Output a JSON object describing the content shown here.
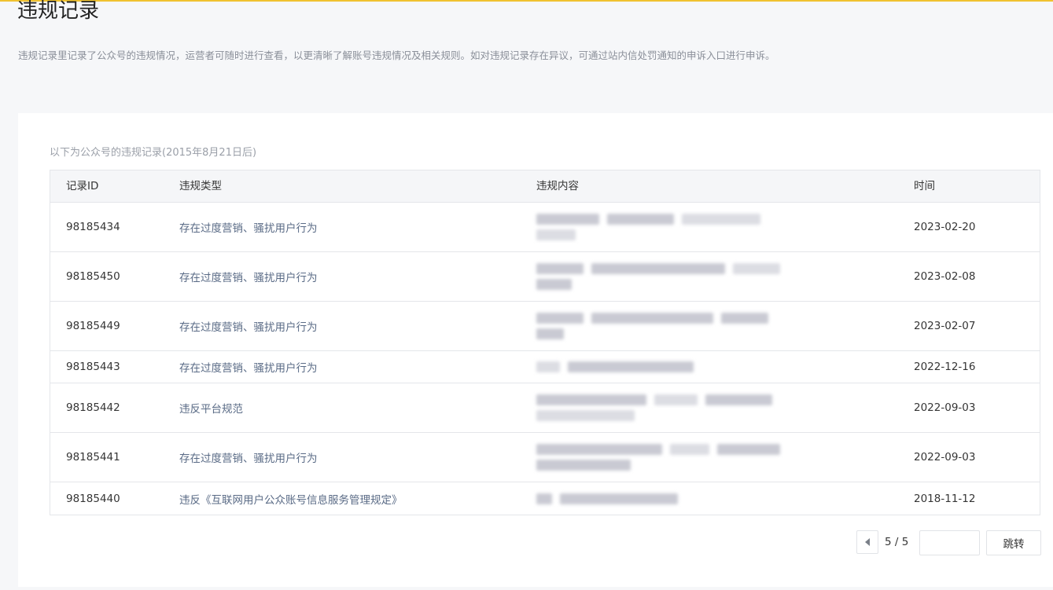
{
  "page": {
    "title": "违规记录",
    "description": "违规记录里记录了公众号的违规情况，运营者可随时进行查看，以更清晰了解账号违规情况及相关规则。如对违规记录存在异议，可通过站内信处罚通知的申诉入口进行申诉。",
    "accent_color": "#f0c230"
  },
  "table": {
    "caption": "以下为公众号的违规记录(2015年8月21日后)",
    "headers": {
      "id": "记录ID",
      "type": "违规类型",
      "content": "违规内容",
      "time": "时间"
    },
    "rows": [
      {
        "id": "98185434",
        "type": "存在过度营销、骚扰用户行为",
        "time": "2023-02-20"
      },
      {
        "id": "98185450",
        "type": "存在过度营销、骚扰用户行为",
        "time": "2023-02-08"
      },
      {
        "id": "98185449",
        "type": "存在过度营销、骚扰用户行为",
        "time": "2023-02-07"
      },
      {
        "id": "98185443",
        "type": "存在过度营销、骚扰用户行为",
        "time": "2022-12-16"
      },
      {
        "id": "98185442",
        "type": "违反平台规范",
        "time": "2022-09-03"
      },
      {
        "id": "98185441",
        "type": "存在过度营销、骚扰用户行为",
        "time": "2022-09-03"
      },
      {
        "id": "98185440",
        "type": "违反《互联网用户公众账号信息服务管理规定》",
        "time": "2018-11-12"
      }
    ]
  },
  "pagination": {
    "page_label": "5 / 5",
    "jump_input_value": "",
    "jump_label": "跳转",
    "prev_icon": "chevron-left-icon"
  }
}
